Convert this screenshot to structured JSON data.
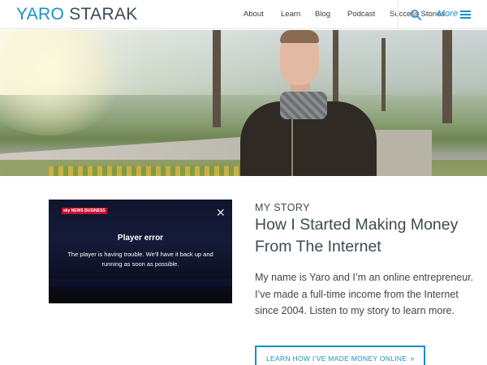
{
  "header": {
    "logo_first": "YARO",
    "logo_last": "STARAK",
    "nav": [
      "About",
      "Learn",
      "Blog",
      "Podcast",
      "Success Stories"
    ],
    "more_label": "More",
    "search_icon": "search-icon",
    "menu_icon": "hamburger-icon",
    "accent_color": "#1a8fc9"
  },
  "video": {
    "logo_tag": "sky NEWS BUSINESS",
    "error_title": "Player error",
    "error_message": "The player is having trouble. We'll have it back up and running as soon as possible.",
    "close_icon": "close-icon"
  },
  "story": {
    "eyebrow": "MY STORY",
    "headline": "How I Started Making Money From The Internet",
    "body": "My name is Yaro and I’m an online entrepreneur. I’ve made a full-time income from the Internet since 2004. Listen to my story to learn more.",
    "cta_label": "LEARN HOW I’VE MADE MONEY ONLINE",
    "cta_icon": "double-chevron-right-icon"
  }
}
